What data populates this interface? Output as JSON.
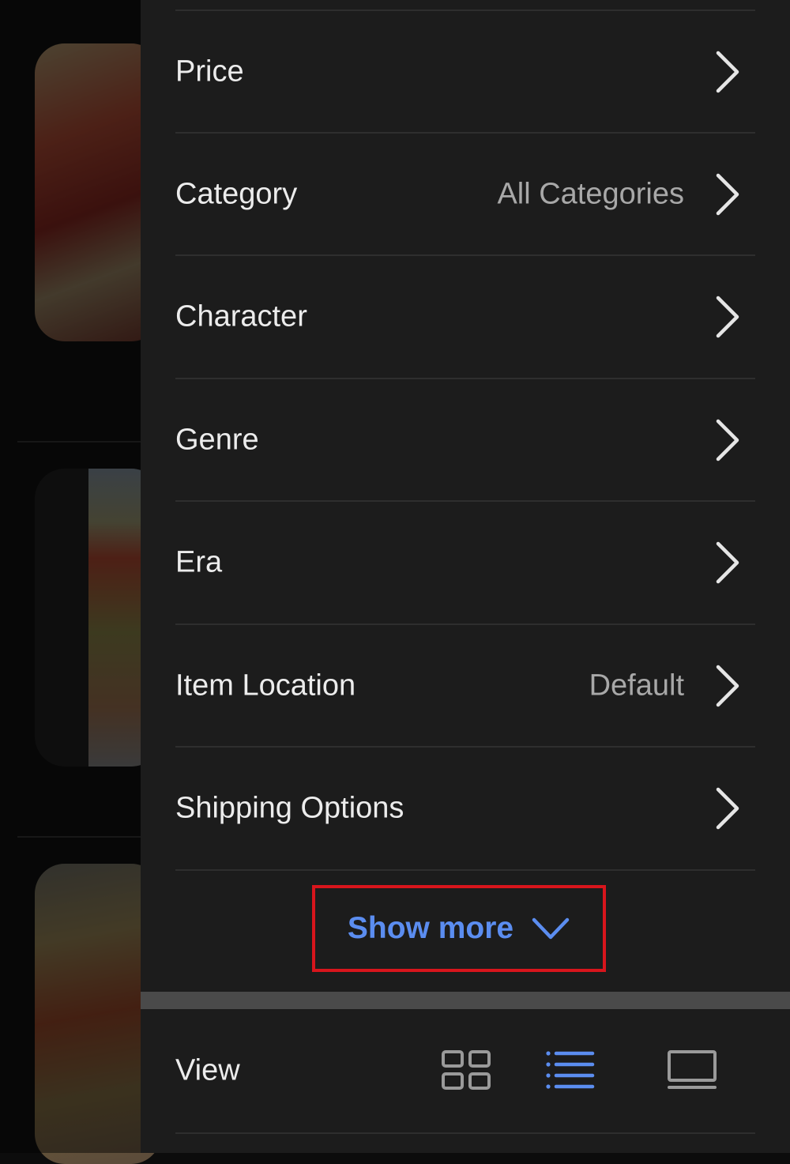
{
  "filters": [
    {
      "label": "Price",
      "value": ""
    },
    {
      "label": "Category",
      "value": "All Categories"
    },
    {
      "label": "Character",
      "value": ""
    },
    {
      "label": "Genre",
      "value": ""
    },
    {
      "label": "Era",
      "value": ""
    },
    {
      "label": "Item Location",
      "value": "Default"
    },
    {
      "label": "Shipping Options",
      "value": ""
    }
  ],
  "show_more": {
    "label": "Show more",
    "icon": "chevron-down-icon"
  },
  "view": {
    "label": "View",
    "options": [
      {
        "name": "grid",
        "icon": "grid-view-icon",
        "selected": false
      },
      {
        "name": "list",
        "icon": "list-view-icon",
        "selected": true
      },
      {
        "name": "gallery",
        "icon": "gallery-view-icon",
        "selected": false
      }
    ]
  },
  "colors": {
    "panel_bg": "#1c1c1c",
    "accent": "#5b8df0",
    "highlight_box": "#d8151c",
    "text": "#ececec",
    "secondary_text": "#a8a8a8"
  }
}
